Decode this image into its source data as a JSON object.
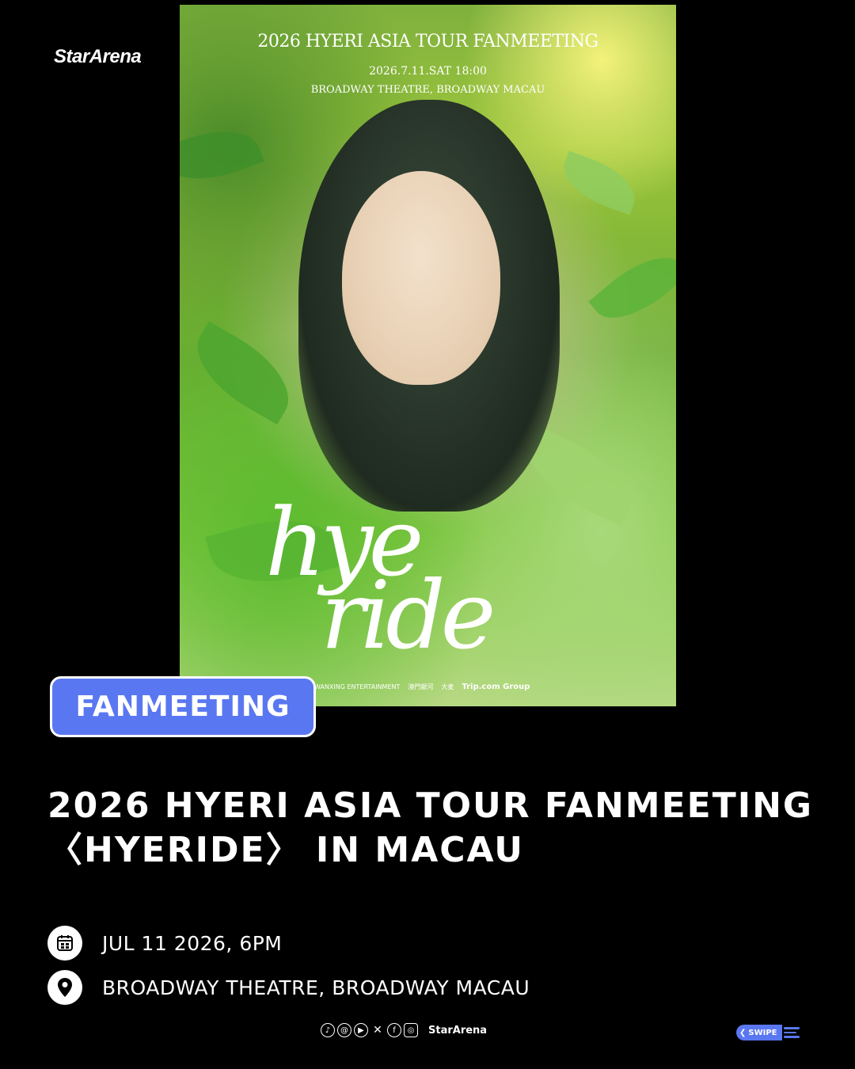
{
  "brand": {
    "logo_text": "StarArena",
    "footer_name": "StarArena"
  },
  "poster": {
    "title": "2026 HYERI ASIA TOUR FANMEETING",
    "date": "2026.7.11.SAT 18:00",
    "venue": "BROADWAY THEATRE, BROADWAY MACAU",
    "script_line1": "hye",
    "script_line2": "ride",
    "sponsors": [
      "WANXING ENTERTAINMENT",
      "澳門銀河",
      "大麦",
      "Trip.com Group"
    ]
  },
  "category_badge": "FANMEETING",
  "headline": {
    "line1": "2026 HYERI ASIA TOUR FANMEETING",
    "line2": "〈HYERIDE〉 IN MACAU"
  },
  "event": {
    "date_text": "JUL 11 2026, 6PM",
    "venue_text": "BROADWAY THEATRE, BROADWAY MACAU"
  },
  "social_icons": [
    "tiktok-icon",
    "threads-icon",
    "youtube-icon",
    "x-icon",
    "facebook-icon",
    "instagram-icon"
  ],
  "swipe_label": "SWIPE",
  "colors": {
    "accent": "#5a77f2",
    "background": "#000000",
    "text": "#ffffff"
  }
}
